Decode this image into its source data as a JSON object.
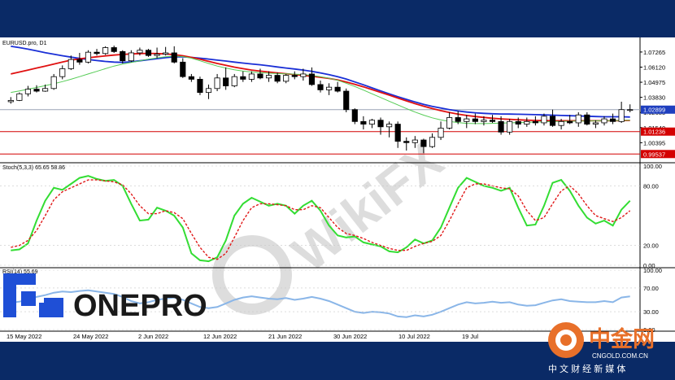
{
  "chart_data": [
    {
      "type": "candlestick",
      "title": "EURUSD.pro, D1",
      "ylim": [
        0.99,
        1.08
      ],
      "y_ticks": [
        "1.07265",
        "1.06120",
        "1.04975",
        "1.03830",
        "1.02685",
        "1.01540",
        "1.00395"
      ],
      "price_tags": [
        {
          "label": "1.02899",
          "value": 1.02899,
          "color": "#1f3fbf"
        },
        {
          "label": "1.01236",
          "value": 1.01236,
          "color": "#d40000"
        },
        {
          "label": "0.99537",
          "value": 0.99537,
          "color": "#d40000"
        }
      ],
      "horizontal_lines": [
        {
          "value": 1.02899,
          "color": "#9aa4b5"
        },
        {
          "value": 1.01236,
          "color": "#d40000"
        },
        {
          "value": 0.99537,
          "color": "#d40000"
        }
      ],
      "candles": [
        {
          "o": 1.035,
          "h": 1.0385,
          "l": 1.0335,
          "c": 1.036
        },
        {
          "o": 1.036,
          "h": 1.042,
          "l": 1.0355,
          "c": 1.041
        },
        {
          "o": 1.041,
          "h": 1.047,
          "l": 1.039,
          "c": 1.0445
        },
        {
          "o": 1.0445,
          "h": 1.0475,
          "l": 1.042,
          "c": 1.043
        },
        {
          "o": 1.043,
          "h": 1.048,
          "l": 1.0425,
          "c": 1.045
        },
        {
          "o": 1.045,
          "h": 1.056,
          "l": 1.044,
          "c": 1.054
        },
        {
          "o": 1.054,
          "h": 1.0625,
          "l": 1.052,
          "c": 1.06
        },
        {
          "o": 1.06,
          "h": 1.07,
          "l": 1.059,
          "c": 1.067
        },
        {
          "o": 1.067,
          "h": 1.072,
          "l": 1.063,
          "c": 1.065
        },
        {
          "o": 1.065,
          "h": 1.074,
          "l": 1.064,
          "c": 1.0725
        },
        {
          "o": 1.0725,
          "h": 1.075,
          "l": 1.07,
          "c": 1.0715
        },
        {
          "o": 1.0715,
          "h": 1.077,
          "l": 1.0705,
          "c": 1.076
        },
        {
          "o": 1.076,
          "h": 1.0775,
          "l": 1.072,
          "c": 1.073
        },
        {
          "o": 1.073,
          "h": 1.074,
          "l": 1.064,
          "c": 1.066
        },
        {
          "o": 1.066,
          "h": 1.074,
          "l": 1.065,
          "c": 1.072
        },
        {
          "o": 1.072,
          "h": 1.076,
          "l": 1.07,
          "c": 1.074
        },
        {
          "o": 1.074,
          "h": 1.075,
          "l": 1.069,
          "c": 1.07
        },
        {
          "o": 1.07,
          "h": 1.076,
          "l": 1.068,
          "c": 1.071
        },
        {
          "o": 1.071,
          "h": 1.0765,
          "l": 1.07,
          "c": 1.072
        },
        {
          "o": 1.072,
          "h": 1.077,
          "l": 1.064,
          "c": 1.065
        },
        {
          "o": 1.065,
          "h": 1.068,
          "l": 1.053,
          "c": 1.054
        },
        {
          "o": 1.054,
          "h": 1.056,
          "l": 1.05,
          "c": 1.052
        },
        {
          "o": 1.052,
          "h": 1.054,
          "l": 1.04,
          "c": 1.042
        },
        {
          "o": 1.042,
          "h": 1.048,
          "l": 1.037,
          "c": 1.045
        },
        {
          "o": 1.045,
          "h": 1.056,
          "l": 1.043,
          "c": 1.053
        },
        {
          "o": 1.053,
          "h": 1.061,
          "l": 1.044,
          "c": 1.047
        },
        {
          "o": 1.047,
          "h": 1.056,
          "l": 1.046,
          "c": 1.054
        },
        {
          "o": 1.054,
          "h": 1.058,
          "l": 1.05,
          "c": 1.052
        },
        {
          "o": 1.052,
          "h": 1.058,
          "l": 1.05,
          "c": 1.056
        },
        {
          "o": 1.056,
          "h": 1.06,
          "l": 1.052,
          "c": 1.053
        },
        {
          "o": 1.053,
          "h": 1.058,
          "l": 1.05,
          "c": 1.055
        },
        {
          "o": 1.055,
          "h": 1.057,
          "l": 1.049,
          "c": 1.0505
        },
        {
          "o": 1.0505,
          "h": 1.056,
          "l": 1.049,
          "c": 1.055
        },
        {
          "o": 1.055,
          "h": 1.058,
          "l": 1.052,
          "c": 1.054
        },
        {
          "o": 1.054,
          "h": 1.06,
          "l": 1.051,
          "c": 1.056
        },
        {
          "o": 1.056,
          "h": 1.061,
          "l": 1.047,
          "c": 1.048
        },
        {
          "o": 1.048,
          "h": 1.051,
          "l": 1.042,
          "c": 1.044
        },
        {
          "o": 1.044,
          "h": 1.049,
          "l": 1.04,
          "c": 1.046
        },
        {
          "o": 1.046,
          "h": 1.05,
          "l": 1.042,
          "c": 1.043
        },
        {
          "o": 1.043,
          "h": 1.045,
          "l": 1.027,
          "c": 1.029
        },
        {
          "o": 1.029,
          "h": 1.03,
          "l": 1.018,
          "c": 1.02
        },
        {
          "o": 1.02,
          "h": 1.024,
          "l": 1.014,
          "c": 1.018
        },
        {
          "o": 1.018,
          "h": 1.022,
          "l": 1.015,
          "c": 1.021
        },
        {
          "o": 1.021,
          "h": 1.023,
          "l": 1.01,
          "c": 1.016
        },
        {
          "o": 1.016,
          "h": 1.02,
          "l": 1.008,
          "c": 1.018
        },
        {
          "o": 1.018,
          "h": 1.02,
          "l": 1.0,
          "c": 1.005
        },
        {
          "o": 1.005,
          "h": 1.008,
          "l": 0.998,
          "c": 1.004
        },
        {
          "o": 1.004,
          "h": 1.009,
          "l": 1.0,
          "c": 1.006
        },
        {
          "o": 1.006,
          "h": 1.007,
          "l": 0.996,
          "c": 1.001
        },
        {
          "o": 1.001,
          "h": 1.011,
          "l": 1.0,
          "c": 1.008
        },
        {
          "o": 1.008,
          "h": 1.02,
          "l": 1.006,
          "c": 1.015
        },
        {
          "o": 1.015,
          "h": 1.027,
          "l": 1.014,
          "c": 1.023
        },
        {
          "o": 1.023,
          "h": 1.028,
          "l": 1.018,
          "c": 1.02
        },
        {
          "o": 1.02,
          "h": 1.025,
          "l": 1.015,
          "c": 1.022
        },
        {
          "o": 1.022,
          "h": 1.026,
          "l": 1.018,
          "c": 1.02
        },
        {
          "o": 1.02,
          "h": 1.024,
          "l": 1.017,
          "c": 1.021
        },
        {
          "o": 1.021,
          "h": 1.025,
          "l": 1.019,
          "c": 1.02
        },
        {
          "o": 1.02,
          "h": 1.024,
          "l": 1.01,
          "c": 1.012
        },
        {
          "o": 1.012,
          "h": 1.022,
          "l": 1.01,
          "c": 1.02
        },
        {
          "o": 1.02,
          "h": 1.023,
          "l": 1.015,
          "c": 1.018
        },
        {
          "o": 1.018,
          "h": 1.023,
          "l": 1.016,
          "c": 1.02
        },
        {
          "o": 1.02,
          "h": 1.024,
          "l": 1.017,
          "c": 1.019
        },
        {
          "o": 1.019,
          "h": 1.026,
          "l": 1.017,
          "c": 1.024
        },
        {
          "o": 1.024,
          "h": 1.029,
          "l": 1.016,
          "c": 1.017
        },
        {
          "o": 1.017,
          "h": 1.022,
          "l": 1.014,
          "c": 1.02
        },
        {
          "o": 1.02,
          "h": 1.025,
          "l": 1.018,
          "c": 1.019
        },
        {
          "o": 1.019,
          "h": 1.027,
          "l": 1.016,
          "c": 1.025
        },
        {
          "o": 1.025,
          "h": 1.027,
          "l": 1.017,
          "c": 1.018
        },
        {
          "o": 1.018,
          "h": 1.021,
          "l": 1.015,
          "c": 1.019
        },
        {
          "o": 1.019,
          "h": 1.024,
          "l": 1.017,
          "c": 1.022
        },
        {
          "o": 1.022,
          "h": 1.026,
          "l": 1.018,
          "c": 1.02
        },
        {
          "o": 1.02,
          "h": 1.035,
          "l": 1.019,
          "c": 1.029
        },
        {
          "o": 1.029,
          "h": 1.033,
          "l": 1.027,
          "c": 1.029
        }
      ],
      "moving_averages": [
        {
          "color": "#1a2fd6",
          "values": [
            1.077,
            1.076,
            1.0748,
            1.0735,
            1.0722,
            1.071,
            1.0698,
            1.0688,
            1.0678,
            1.067,
            1.0662,
            1.0655,
            1.065,
            1.0648,
            1.0652,
            1.066,
            1.0668,
            1.0676,
            1.0684,
            1.069,
            1.069,
            1.0686,
            1.068,
            1.0673,
            1.0665,
            1.0658,
            1.065,
            1.0643,
            1.0636,
            1.063,
            1.0622,
            1.0613,
            1.0605,
            1.0598,
            1.059,
            1.058,
            1.0568,
            1.0555,
            1.054,
            1.0522,
            1.05,
            1.0478,
            1.0455,
            1.0432,
            1.041,
            1.0388,
            1.0368,
            1.0348,
            1.033,
            1.0315,
            1.0302,
            1.029,
            1.028,
            1.0272,
            1.0266,
            1.0262,
            1.0259,
            1.0257,
            1.0256,
            1.0255,
            1.0254,
            1.0252,
            1.025,
            1.0248,
            1.0246,
            1.0244,
            1.0242,
            1.024,
            1.0238,
            1.0236,
            1.0236,
            1.0236,
            1.0234
          ]
        },
        {
          "color": "#e01010",
          "values": [
            1.056,
            1.0575,
            1.059,
            1.0605,
            1.062,
            1.0635,
            1.065,
            1.0665,
            1.0675,
            1.0683,
            1.069,
            1.0697,
            1.0703,
            1.0708,
            1.0712,
            1.0715,
            1.0716,
            1.0715,
            1.0712,
            1.0707,
            1.0698,
            1.0686,
            1.0672,
            1.0656,
            1.064,
            1.0626,
            1.0612,
            1.06,
            1.059,
            1.0582,
            1.0575,
            1.0568,
            1.0562,
            1.0556,
            1.055,
            1.0543,
            1.0535,
            1.0526,
            1.0515,
            1.05,
            1.0482,
            1.0463,
            1.0442,
            1.0421,
            1.04,
            1.0378,
            1.0356,
            1.0335,
            1.0316,
            1.0298,
            1.0282,
            1.0268,
            1.0256,
            1.0246,
            1.0238,
            1.0231,
            1.0225,
            1.022,
            1.0216,
            1.0213,
            1.021,
            1.0208,
            1.0207,
            1.0206,
            1.0206,
            1.0206,
            1.0206,
            1.0206,
            1.0206,
            1.0206,
            1.0206,
            1.0207,
            1.0208
          ]
        },
        {
          "color": "#55cc55",
          "values": [
            1.042,
            1.0432,
            1.0445,
            1.0458,
            1.0472,
            1.0486,
            1.0502,
            1.052,
            1.054,
            1.056,
            1.058,
            1.06,
            1.062,
            1.0635,
            1.0648,
            1.066,
            1.0672,
            1.0682,
            1.069,
            1.0695,
            1.0692,
            1.068,
            1.066,
            1.064,
            1.062,
            1.0605,
            1.0592,
            1.0582,
            1.0575,
            1.057,
            1.0566,
            1.0563,
            1.0561,
            1.0559,
            1.0556,
            1.055,
            1.054,
            1.0528,
            1.0512,
            1.049,
            1.0465,
            1.0438,
            1.041,
            1.0382,
            1.0354,
            1.0326,
            1.0298,
            1.0272,
            1.0248,
            1.0228,
            1.0212,
            1.02,
            1.0192,
            1.0186,
            1.0184,
            1.0184,
            1.0186,
            1.0188,
            1.019,
            1.0192,
            1.0194,
            1.0196,
            1.0198,
            1.02,
            1.0201,
            1.0202,
            1.0203,
            1.0204,
            1.0205,
            1.0206,
            1.0207,
            1.0208,
            1.021
          ]
        }
      ]
    },
    {
      "type": "line",
      "title": "Stoch(5,3,3) 65.65 58.86",
      "ylim": [
        0,
        100
      ],
      "y_ticks": [
        "100.00",
        "80.00",
        "20.00",
        "0.00"
      ],
      "series": [
        {
          "color": "#33dd33",
          "values": [
            15,
            16,
            22,
            45,
            65,
            78,
            76,
            82,
            88,
            90,
            87,
            85,
            86,
            80,
            62,
            45,
            46,
            58,
            55,
            50,
            38,
            12,
            5,
            4,
            8,
            25,
            50,
            62,
            68,
            64,
            60,
            62,
            60,
            52,
            60,
            65,
            55,
            40,
            30,
            28,
            29,
            23,
            21,
            19,
            14,
            13,
            18,
            26,
            22,
            25,
            38,
            58,
            78,
            88,
            84,
            80,
            78,
            75,
            78,
            58,
            40,
            41,
            60,
            83,
            86,
            75,
            60,
            48,
            42,
            45,
            40,
            56,
            65
          ]
        },
        {
          "color": "#e01818",
          "values": [
            18,
            20,
            25,
            35,
            50,
            66,
            74,
            78,
            82,
            86,
            86,
            85,
            84,
            81,
            72,
            60,
            52,
            52,
            55,
            53,
            47,
            32,
            18,
            8,
            6,
            12,
            28,
            45,
            58,
            62,
            62,
            61,
            60,
            56,
            56,
            60,
            58,
            48,
            38,
            32,
            30,
            27,
            23,
            20,
            17,
            15,
            15,
            19,
            22,
            24,
            30,
            45,
            62,
            78,
            82,
            82,
            80,
            78,
            77,
            70,
            55,
            45,
            48,
            62,
            75,
            80,
            72,
            60,
            50,
            47,
            44,
            48,
            55
          ]
        }
      ]
    },
    {
      "type": "line",
      "title": "RSI(14) 55.69",
      "ylim": [
        0,
        100
      ],
      "y_ticks": [
        "100.00",
        "70.00",
        "30.00",
        "0.00"
      ],
      "series": [
        {
          "color": "#8ab6e8",
          "values": [
            45,
            47,
            50,
            55,
            58,
            62,
            64,
            63,
            65,
            66,
            64,
            62,
            60,
            55,
            48,
            44,
            46,
            50,
            52,
            54,
            50,
            44,
            38,
            36,
            38,
            44,
            50,
            54,
            56,
            54,
            52,
            51,
            53,
            50,
            52,
            55,
            52,
            48,
            42,
            36,
            30,
            28,
            30,
            29,
            27,
            22,
            21,
            24,
            22,
            25,
            30,
            36,
            42,
            46,
            44,
            45,
            47,
            45,
            46,
            42,
            40,
            41,
            45,
            49,
            51,
            48,
            47,
            46,
            46,
            48,
            46,
            54,
            55.69
          ]
        }
      ]
    }
  ],
  "x_axis_labels": [
    "15 May 2022",
    "24 May 2022",
    "2 Jun 2022",
    "12 Jun 2022",
    "21 Jun 2022",
    "30 Jun 2022",
    "10 Jul 2022",
    "19 Jul"
  ],
  "watermark": "WikiFX",
  "logos": {
    "onepro": "ONEPRO",
    "cngold_cn": "中金网",
    "cngold_en": "CNGOLD.COM.CN",
    "cngold_tagline": "中 文 财 经 新 媒 体"
  },
  "colors": {
    "background_frame": "#0a2a66",
    "bull": "#ffffff",
    "bear": "#000000"
  }
}
